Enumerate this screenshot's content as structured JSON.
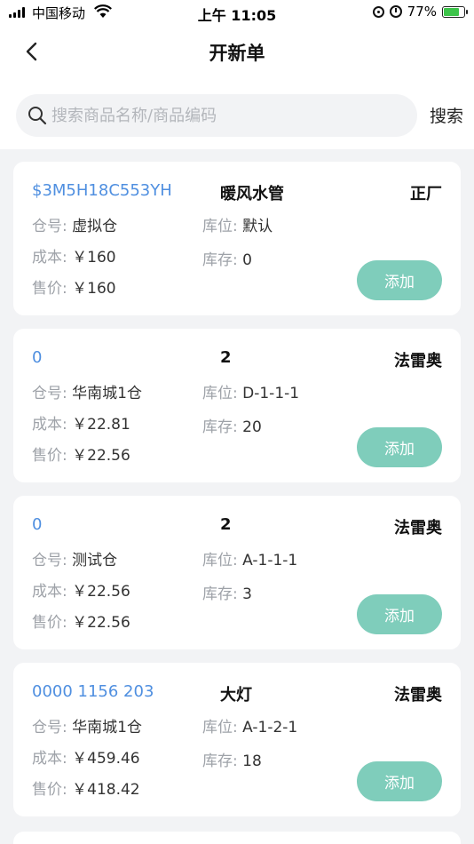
{
  "status_bar": {
    "carrier": "中国移动",
    "time": "上午 11:05",
    "battery": "77%",
    "battery_level": 0.77
  },
  "nav": {
    "title": "开新单"
  },
  "search": {
    "placeholder": "搜索商品名称/商品编码",
    "button_label": "搜索"
  },
  "labels": {
    "warehouse": "仓号:",
    "location": "库位:",
    "cost": "成本:",
    "stock": "库存:",
    "price": "售价:",
    "add": "添加"
  },
  "products": [
    {
      "code": "$3M5H18C553YH",
      "name": "暖风水管",
      "brand": "正厂",
      "warehouse": "虚拟仓",
      "location": "默认",
      "cost": "￥160",
      "stock": "0",
      "price": "￥160"
    },
    {
      "code": "0",
      "name": "2",
      "brand": "法雷奥",
      "warehouse": "华南城1仓",
      "location": "D-1-1-1",
      "cost": "￥22.81",
      "stock": "20",
      "price": "￥22.56"
    },
    {
      "code": "0",
      "name": "2",
      "brand": "法雷奥",
      "warehouse": "测试仓",
      "location": "A-1-1-1",
      "cost": "￥22.56",
      "stock": "3",
      "price": "￥22.56"
    },
    {
      "code": "0000 1156 203",
      "name": "大灯",
      "brand": "法雷奥",
      "warehouse": "华南城1仓",
      "location": "A-1-2-1",
      "cost": "￥459.46",
      "stock": "18",
      "price": "￥418.42"
    }
  ],
  "colors": {
    "accent_code": "#4f8fe0",
    "add_button": "#7fcdbb",
    "label_gray": "#9ea2a8",
    "background": "#f2f3f5"
  }
}
